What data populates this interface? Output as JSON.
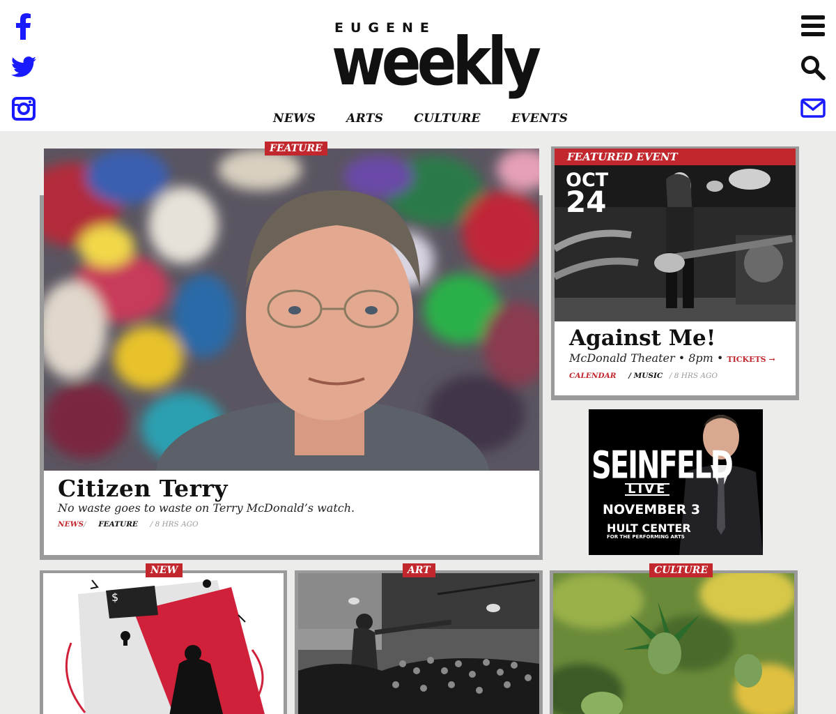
{
  "header": {
    "logo_top": "EUGENE",
    "logo_main": "weekly",
    "social": [
      "facebook-icon",
      "twitter-icon",
      "instagram-icon"
    ],
    "right_icons": [
      "menu-icon",
      "search-icon",
      "mail-icon"
    ],
    "nav": [
      "NEWS",
      "ARTS",
      "CULTURE",
      "EVENTS"
    ]
  },
  "feature": {
    "tag": "FEATURE",
    "title": "Citizen Terry",
    "subtitle": "No waste goes to waste on Terry McDonald’s watch.",
    "meta_section": "NEWS",
    "meta_sep": "/",
    "meta_type": "FEATURE",
    "meta_time": "/ 8 HRS AGO"
  },
  "featured_event": {
    "heading": "FEATURED EVENT",
    "month": "OCT",
    "day": "24",
    "title": "Against Me!",
    "subtitle": "McDonald Theater • 8pm •",
    "tickets": "TICKETS →",
    "meta_section": "CALENDAR",
    "meta_type": "/ MUSIC",
    "meta_time": "/ 8 HRS AGO"
  },
  "ad": {
    "title": "SEINFELD",
    "live": "LIVE",
    "date": "NOVEMBER 3",
    "venue": "HULT CENTER",
    "venue_sub": "FOR THE PERFORMING ARTS"
  },
  "cards": [
    {
      "tag": "NEW"
    },
    {
      "tag": "ART"
    },
    {
      "tag": "CULTURE"
    }
  ],
  "colors": {
    "accent": "#c1272d",
    "social_blue": "#1a1aff",
    "background": "#ececea"
  }
}
